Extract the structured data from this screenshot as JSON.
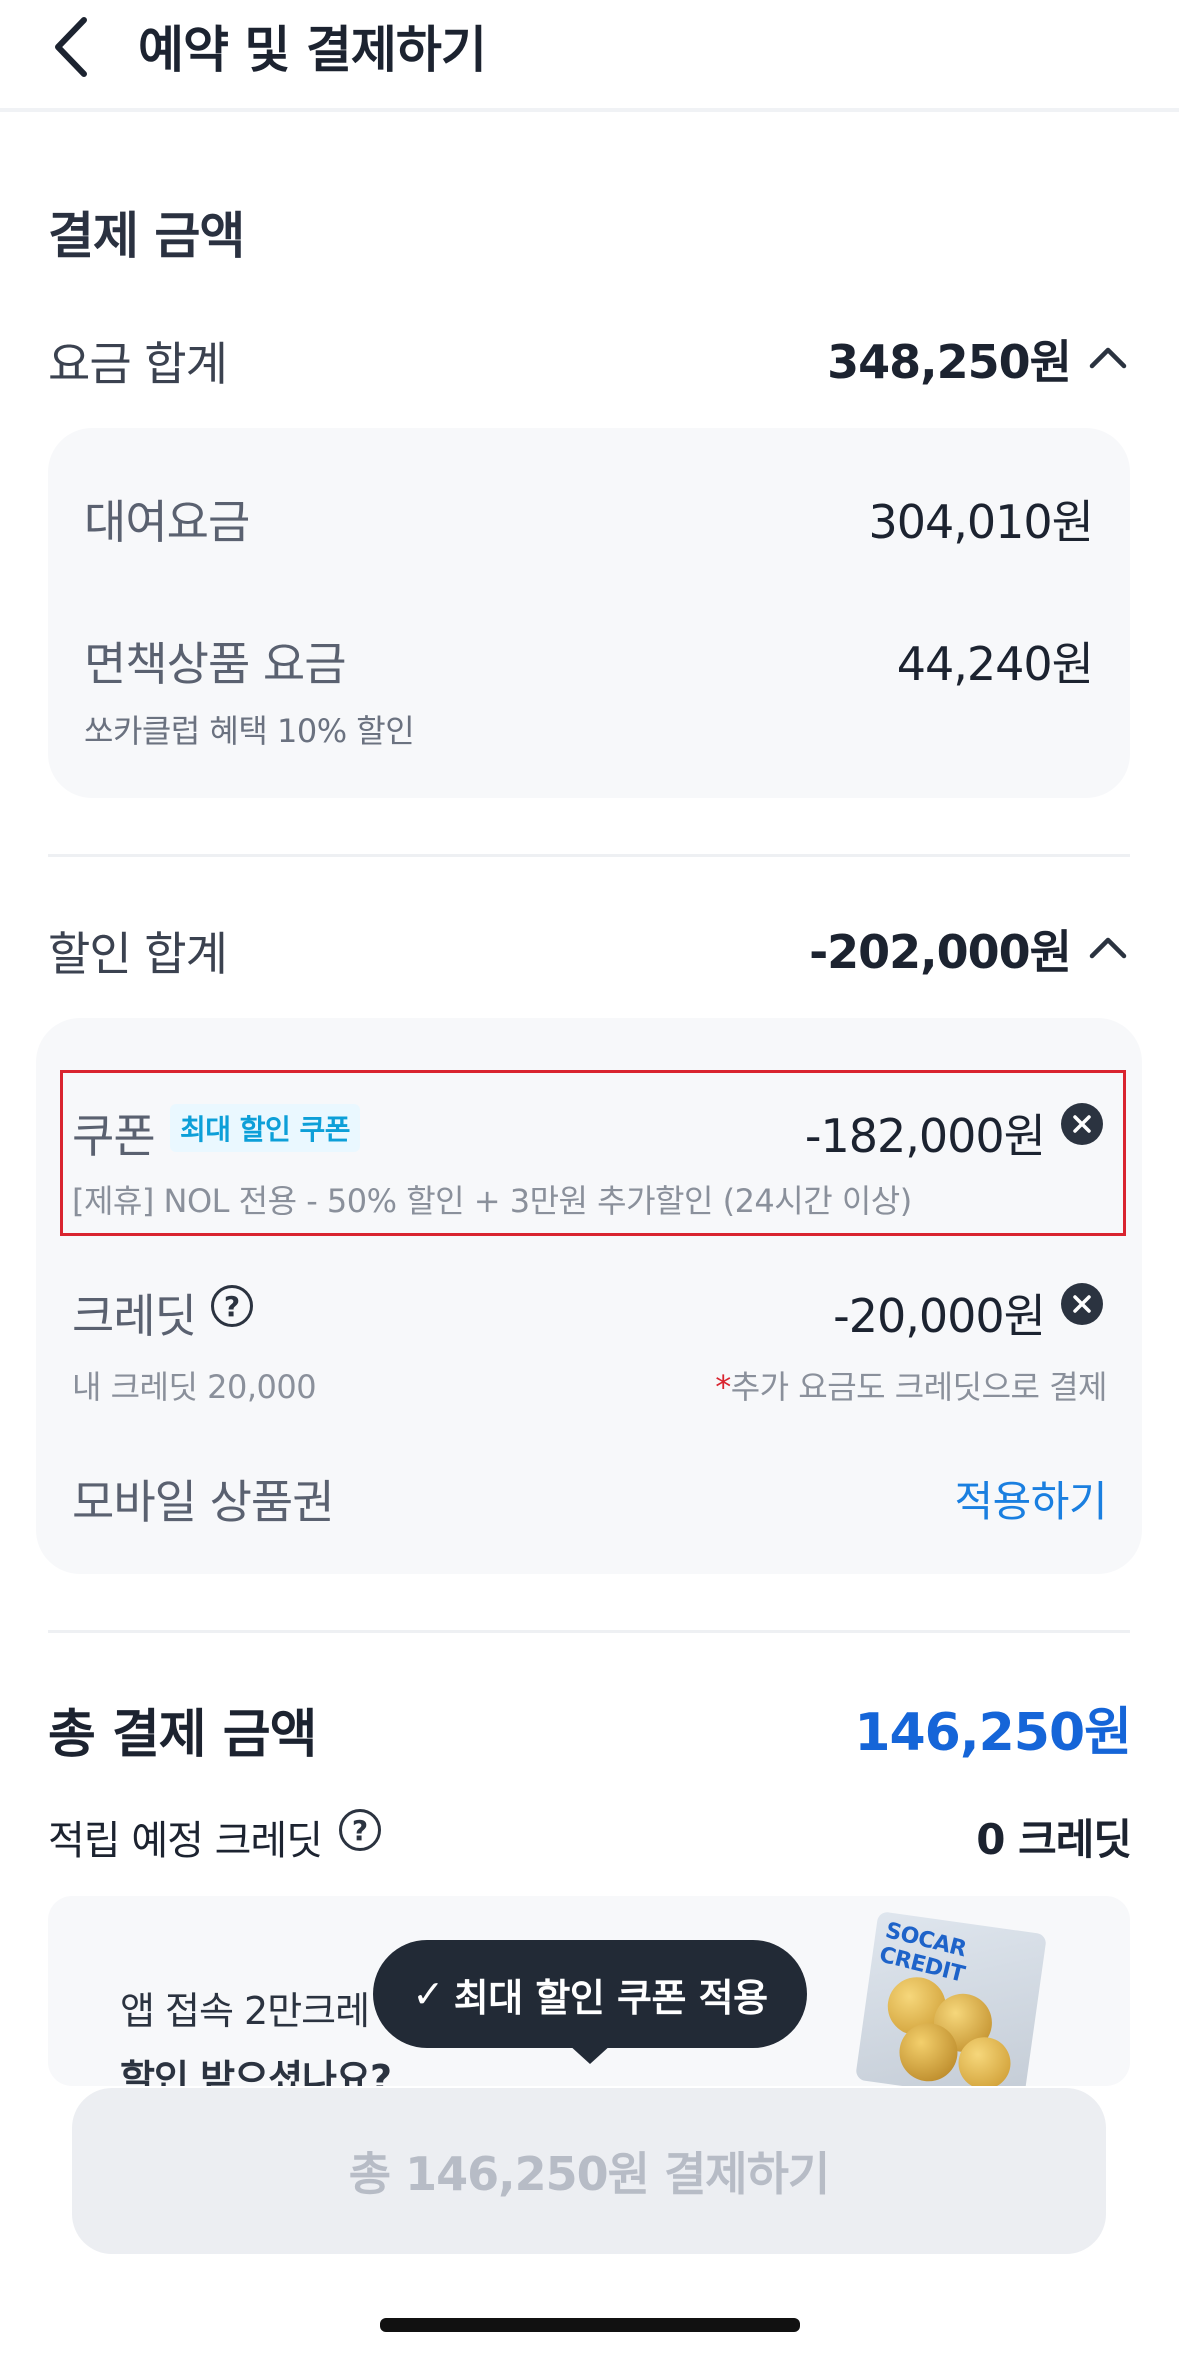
{
  "header": {
    "title": "예약 및 결제하기"
  },
  "payment": {
    "section_title": "결제 금액",
    "fare_total_label": "요금 합계",
    "fare_total_value": "348,250원",
    "fare_items": [
      {
        "label": "대여요금",
        "value": "304,010원"
      },
      {
        "label": "면책상품 요금",
        "value": "44,240원",
        "note": "쏘카클럽 혜택 10% 할인"
      }
    ],
    "discount_total_label": "할인 합계",
    "discount_total_value": "-202,000원",
    "coupon": {
      "label": "쿠폰",
      "badge": "최대 할인 쿠폰",
      "value": "-182,000원",
      "desc": "[제휴] NOL 전용 - 50% 할인 + 3만원 추가할인 (24시간 이상)"
    },
    "credit": {
      "label": "크레딧",
      "help": "?",
      "value": "-20,000원",
      "balance": "내 크레딧 20,000",
      "note_mark": "*",
      "note": "추가 요금도 크레딧으로 결제"
    },
    "voucher": {
      "label": "모바일 상품권",
      "action": "적용하기"
    },
    "total_label": "총 결제 금액",
    "total_value": "146,250원",
    "earn_label": "적립 예정 크레딧",
    "earn_help": "?",
    "earn_value": "0 크레딧"
  },
  "promo": {
    "line1": "앱 접속 2만크레",
    "line2": "할인 받으셨나요?",
    "image_text": "SOCAR CREDIT"
  },
  "toast": {
    "check": "✓",
    "text": "최대 할인 쿠폰 적용"
  },
  "pay_button": {
    "label": "총 146,250원 결제하기"
  },
  "colors": {
    "accent_blue": "#1a7fe0",
    "total_blue": "#1565d8",
    "highlight_red": "#d9242f",
    "badge_cyan": "#0d9fd8"
  }
}
